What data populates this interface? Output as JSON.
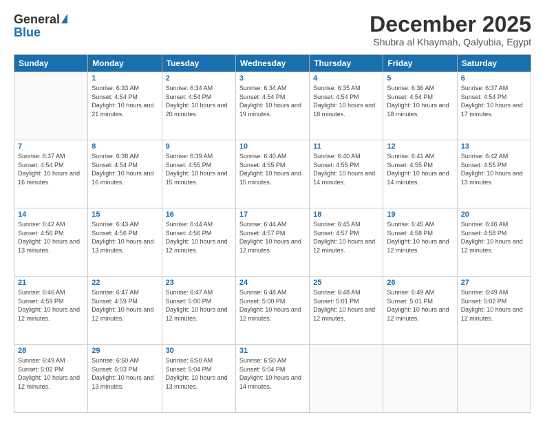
{
  "header": {
    "logo_general": "General",
    "logo_blue": "Blue",
    "month_title": "December 2025",
    "location": "Shubra al Khaymah, Qalyubia, Egypt"
  },
  "days_of_week": [
    "Sunday",
    "Monday",
    "Tuesday",
    "Wednesday",
    "Thursday",
    "Friday",
    "Saturday"
  ],
  "weeks": [
    [
      {
        "day": "",
        "sunrise": "",
        "sunset": "",
        "daylight": ""
      },
      {
        "day": "1",
        "sunrise": "Sunrise: 6:33 AM",
        "sunset": "Sunset: 4:54 PM",
        "daylight": "Daylight: 10 hours and 21 minutes."
      },
      {
        "day": "2",
        "sunrise": "Sunrise: 6:34 AM",
        "sunset": "Sunset: 4:54 PM",
        "daylight": "Daylight: 10 hours and 20 minutes."
      },
      {
        "day": "3",
        "sunrise": "Sunrise: 6:34 AM",
        "sunset": "Sunset: 4:54 PM",
        "daylight": "Daylight: 10 hours and 19 minutes."
      },
      {
        "day": "4",
        "sunrise": "Sunrise: 6:35 AM",
        "sunset": "Sunset: 4:54 PM",
        "daylight": "Daylight: 10 hours and 18 minutes."
      },
      {
        "day": "5",
        "sunrise": "Sunrise: 6:36 AM",
        "sunset": "Sunset: 4:54 PM",
        "daylight": "Daylight: 10 hours and 18 minutes."
      },
      {
        "day": "6",
        "sunrise": "Sunrise: 6:37 AM",
        "sunset": "Sunset: 4:54 PM",
        "daylight": "Daylight: 10 hours and 17 minutes."
      }
    ],
    [
      {
        "day": "7",
        "sunrise": "Sunrise: 6:37 AM",
        "sunset": "Sunset: 4:54 PM",
        "daylight": "Daylight: 10 hours and 16 minutes."
      },
      {
        "day": "8",
        "sunrise": "Sunrise: 6:38 AM",
        "sunset": "Sunset: 4:54 PM",
        "daylight": "Daylight: 10 hours and 16 minutes."
      },
      {
        "day": "9",
        "sunrise": "Sunrise: 6:39 AM",
        "sunset": "Sunset: 4:55 PM",
        "daylight": "Daylight: 10 hours and 15 minutes."
      },
      {
        "day": "10",
        "sunrise": "Sunrise: 6:40 AM",
        "sunset": "Sunset: 4:55 PM",
        "daylight": "Daylight: 10 hours and 15 minutes."
      },
      {
        "day": "11",
        "sunrise": "Sunrise: 6:40 AM",
        "sunset": "Sunset: 4:55 PM",
        "daylight": "Daylight: 10 hours and 14 minutes."
      },
      {
        "day": "12",
        "sunrise": "Sunrise: 6:41 AM",
        "sunset": "Sunset: 4:55 PM",
        "daylight": "Daylight: 10 hours and 14 minutes."
      },
      {
        "day": "13",
        "sunrise": "Sunrise: 6:42 AM",
        "sunset": "Sunset: 4:55 PM",
        "daylight": "Daylight: 10 hours and 13 minutes."
      }
    ],
    [
      {
        "day": "14",
        "sunrise": "Sunrise: 6:42 AM",
        "sunset": "Sunset: 4:56 PM",
        "daylight": "Daylight: 10 hours and 13 minutes."
      },
      {
        "day": "15",
        "sunrise": "Sunrise: 6:43 AM",
        "sunset": "Sunset: 4:56 PM",
        "daylight": "Daylight: 10 hours and 13 minutes."
      },
      {
        "day": "16",
        "sunrise": "Sunrise: 6:44 AM",
        "sunset": "Sunset: 4:56 PM",
        "daylight": "Daylight: 10 hours and 12 minutes."
      },
      {
        "day": "17",
        "sunrise": "Sunrise: 6:44 AM",
        "sunset": "Sunset: 4:57 PM",
        "daylight": "Daylight: 10 hours and 12 minutes."
      },
      {
        "day": "18",
        "sunrise": "Sunrise: 6:45 AM",
        "sunset": "Sunset: 4:57 PM",
        "daylight": "Daylight: 10 hours and 12 minutes."
      },
      {
        "day": "19",
        "sunrise": "Sunrise: 6:45 AM",
        "sunset": "Sunset: 4:58 PM",
        "daylight": "Daylight: 10 hours and 12 minutes."
      },
      {
        "day": "20",
        "sunrise": "Sunrise: 6:46 AM",
        "sunset": "Sunset: 4:58 PM",
        "daylight": "Daylight: 10 hours and 12 minutes."
      }
    ],
    [
      {
        "day": "21",
        "sunrise": "Sunrise: 6:46 AM",
        "sunset": "Sunset: 4:59 PM",
        "daylight": "Daylight: 10 hours and 12 minutes."
      },
      {
        "day": "22",
        "sunrise": "Sunrise: 6:47 AM",
        "sunset": "Sunset: 4:59 PM",
        "daylight": "Daylight: 10 hours and 12 minutes."
      },
      {
        "day": "23",
        "sunrise": "Sunrise: 6:47 AM",
        "sunset": "Sunset: 5:00 PM",
        "daylight": "Daylight: 10 hours and 12 minutes."
      },
      {
        "day": "24",
        "sunrise": "Sunrise: 6:48 AM",
        "sunset": "Sunset: 5:00 PM",
        "daylight": "Daylight: 10 hours and 12 minutes."
      },
      {
        "day": "25",
        "sunrise": "Sunrise: 6:48 AM",
        "sunset": "Sunset: 5:01 PM",
        "daylight": "Daylight: 10 hours and 12 minutes."
      },
      {
        "day": "26",
        "sunrise": "Sunrise: 6:49 AM",
        "sunset": "Sunset: 5:01 PM",
        "daylight": "Daylight: 10 hours and 12 minutes."
      },
      {
        "day": "27",
        "sunrise": "Sunrise: 6:49 AM",
        "sunset": "Sunset: 5:02 PM",
        "daylight": "Daylight: 10 hours and 12 minutes."
      }
    ],
    [
      {
        "day": "28",
        "sunrise": "Sunrise: 6:49 AM",
        "sunset": "Sunset: 5:02 PM",
        "daylight": "Daylight: 10 hours and 12 minutes."
      },
      {
        "day": "29",
        "sunrise": "Sunrise: 6:50 AM",
        "sunset": "Sunset: 5:03 PM",
        "daylight": "Daylight: 10 hours and 13 minutes."
      },
      {
        "day": "30",
        "sunrise": "Sunrise: 6:50 AM",
        "sunset": "Sunset: 5:04 PM",
        "daylight": "Daylight: 10 hours and 13 minutes."
      },
      {
        "day": "31",
        "sunrise": "Sunrise: 6:50 AM",
        "sunset": "Sunset: 5:04 PM",
        "daylight": "Daylight: 10 hours and 14 minutes."
      },
      {
        "day": "",
        "sunrise": "",
        "sunset": "",
        "daylight": ""
      },
      {
        "day": "",
        "sunrise": "",
        "sunset": "",
        "daylight": ""
      },
      {
        "day": "",
        "sunrise": "",
        "sunset": "",
        "daylight": ""
      }
    ]
  ]
}
